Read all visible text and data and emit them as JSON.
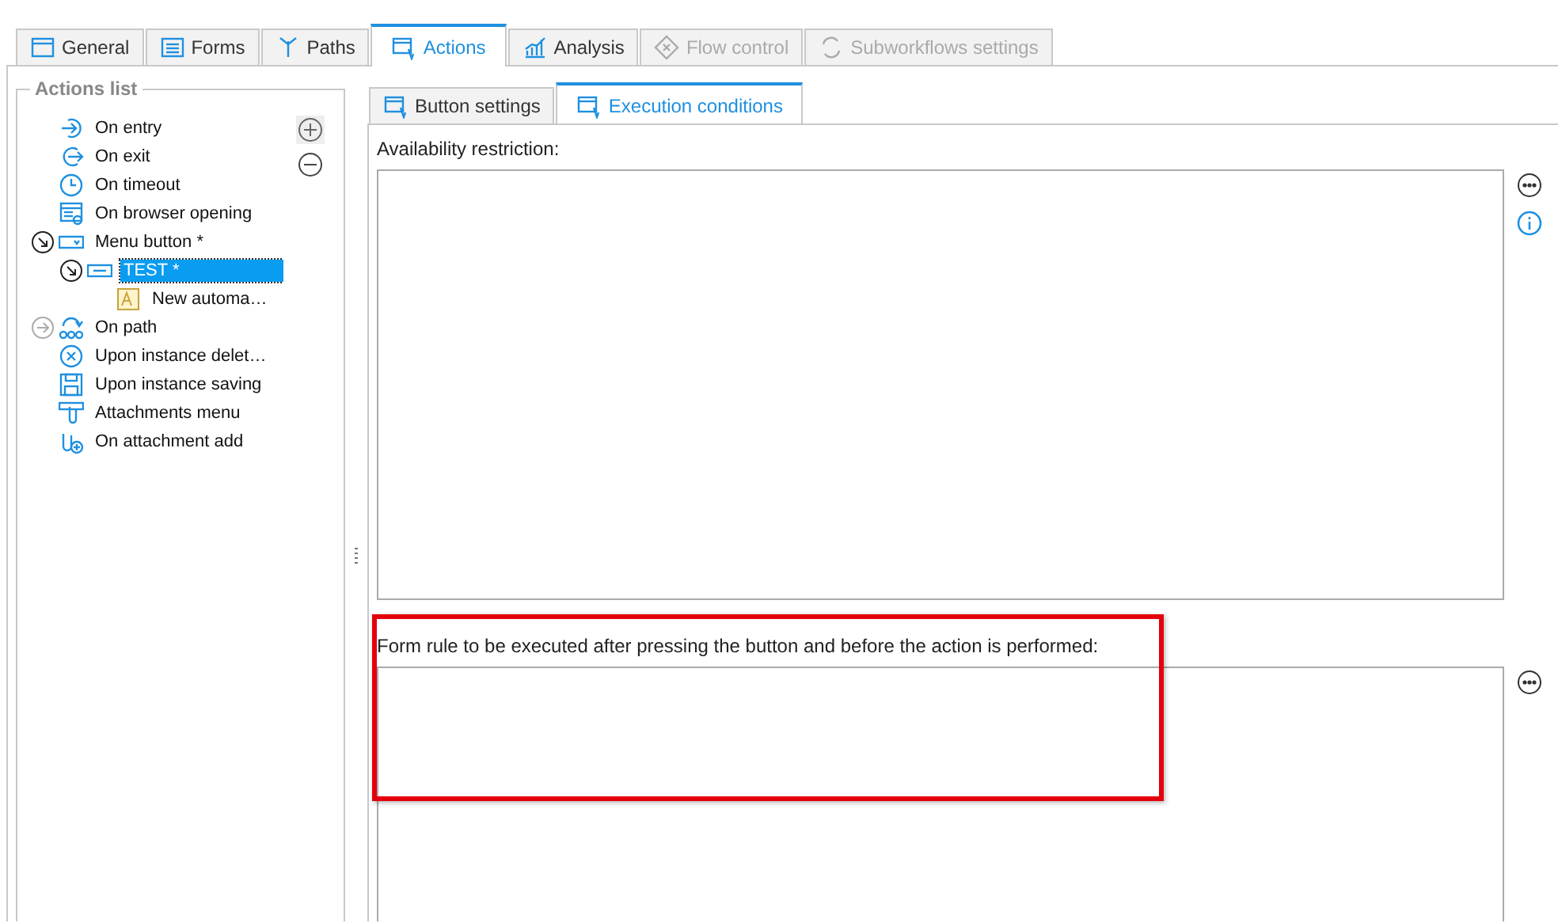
{
  "tabs": [
    {
      "label": "General",
      "kind": "window",
      "selected": false,
      "disabled": false
    },
    {
      "label": "Forms",
      "kind": "form",
      "selected": false,
      "disabled": false
    },
    {
      "label": "Paths",
      "kind": "paths",
      "selected": false,
      "disabled": false
    },
    {
      "label": "Actions",
      "kind": "actions",
      "selected": true,
      "disabled": false
    },
    {
      "label": "Analysis",
      "kind": "chart",
      "selected": false,
      "disabled": false
    },
    {
      "label": "Flow control",
      "kind": "stop",
      "selected": false,
      "disabled": true
    },
    {
      "label": "Subworkflows settings",
      "kind": "cycle",
      "selected": false,
      "disabled": true
    }
  ],
  "actions_list": {
    "title": "Actions list",
    "items": [
      {
        "label": "On entry",
        "kind": "entry",
        "selected": false
      },
      {
        "label": "On exit",
        "kind": "exit",
        "selected": false
      },
      {
        "label": "On timeout",
        "kind": "clock",
        "selected": false
      },
      {
        "label": "On browser opening",
        "kind": "browser",
        "selected": false
      },
      {
        "label": "Menu button *",
        "kind": "menu-button",
        "selected": false,
        "expanded": true,
        "children": [
          {
            "label": "TEST *",
            "kind": "button",
            "selected": true,
            "expanded": true,
            "children": [
              {
                "label": "New automa…",
                "kind": "automation",
                "selected": false
              }
            ]
          }
        ]
      },
      {
        "label": "On path",
        "kind": "path",
        "selected": false,
        "expanded": false
      },
      {
        "label": "Upon instance delet…",
        "kind": "delete",
        "selected": false
      },
      {
        "label": "Upon instance saving",
        "kind": "save",
        "selected": false
      },
      {
        "label": "Attachments menu",
        "kind": "attach-menu",
        "selected": false
      },
      {
        "label": "On attachment add",
        "kind": "attach-add",
        "selected": false
      }
    ]
  },
  "sub_tabs": [
    {
      "label": "Button settings",
      "selected": false
    },
    {
      "label": "Execution conditions",
      "selected": true
    }
  ],
  "fields": [
    {
      "label": "Availability restriction:",
      "info": true
    },
    {
      "label": "Form rule to be executed after pressing the button and before the action is performed:",
      "info": false,
      "highlighted": true
    }
  ]
}
